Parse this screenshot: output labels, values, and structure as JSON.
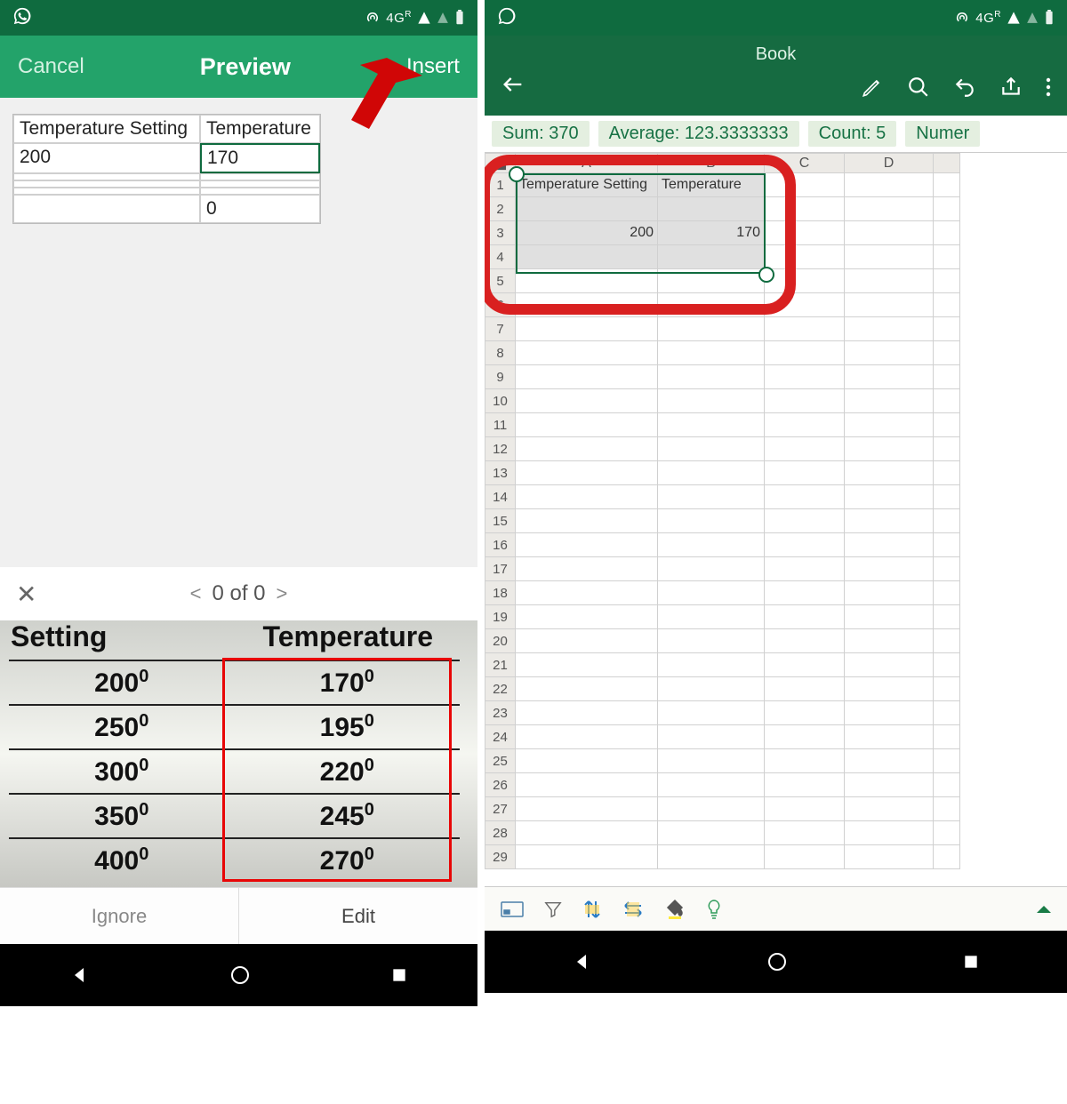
{
  "status": {
    "network": "4G",
    "roam": "R"
  },
  "left": {
    "cancel": "Cancel",
    "title": "Preview",
    "insert": "Insert",
    "preview_table": {
      "headers": [
        "Temperature Setting",
        "Temperature"
      ],
      "row1": [
        "200",
        "170"
      ],
      "row_extra": [
        "",
        "0"
      ]
    },
    "pager": {
      "label": "0 of 0",
      "prev": "<",
      "next": ">"
    },
    "photo_table": {
      "h1": "Setting",
      "h2": "Temperature",
      "rows": [
        {
          "s": "200",
          "t": "170"
        },
        {
          "s": "250",
          "t": "195"
        },
        {
          "s": "300",
          "t": "220"
        },
        {
          "s": "350",
          "t": "245"
        },
        {
          "s": "400",
          "t": "270"
        }
      ]
    },
    "actions": {
      "ignore": "Ignore",
      "edit": "Edit"
    }
  },
  "right": {
    "book": "Book",
    "stats": {
      "sum": "Sum: 370",
      "avg": "Average: 123.3333333",
      "count": "Count: 5",
      "numer": "Numer"
    },
    "columns": [
      "A",
      "B",
      "C",
      "D"
    ],
    "rows": [
      "1",
      "2",
      "3",
      "4",
      "5",
      "6",
      "7",
      "8",
      "9",
      "10",
      "11",
      "12",
      "13",
      "14",
      "15",
      "16",
      "17",
      "18",
      "19",
      "20",
      "21",
      "22",
      "23",
      "24",
      "25",
      "26",
      "27",
      "28",
      "29"
    ],
    "cells": {
      "A1": "Temperature Setting",
      "B1": "Temperature",
      "A3": "200",
      "B3": "170"
    }
  }
}
